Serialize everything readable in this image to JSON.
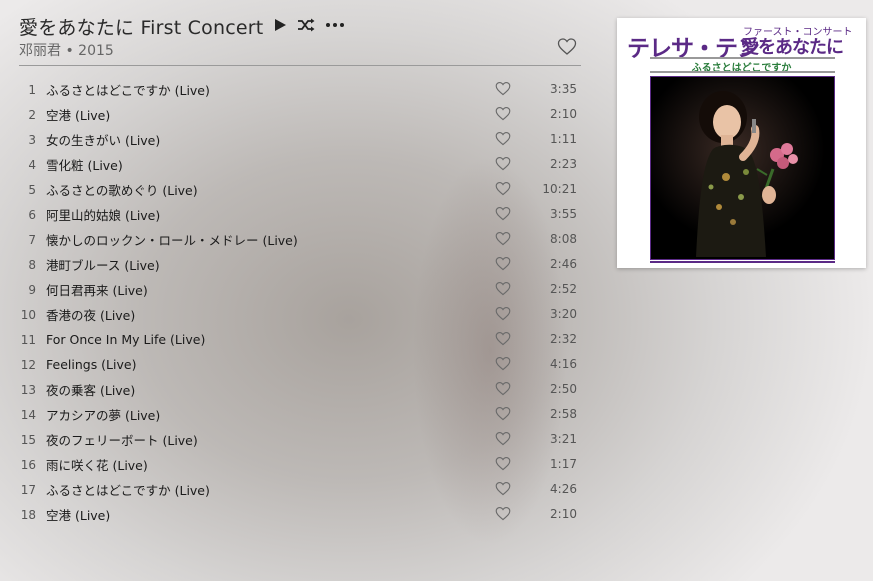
{
  "album": {
    "title": "愛をあなたに First Concert",
    "artist": "邓丽君",
    "year": "2015",
    "controls": [
      "play-icon",
      "shuffle-icon",
      "more-icon"
    ]
  },
  "cover": {
    "big_title": "テレサ・テン",
    "small_title": "ファースト・コンサート",
    "big_title2": "愛をあなたに",
    "subtitle": "ふるさとはどこですか"
  },
  "tracks": [
    {
      "num": "1",
      "title": "ふるさとはどこですか (Live)",
      "duration": "3:35"
    },
    {
      "num": "2",
      "title": "空港 (Live)",
      "duration": "2:10"
    },
    {
      "num": "3",
      "title": "女の生きがい (Live)",
      "duration": "1:11"
    },
    {
      "num": "4",
      "title": "雪化粧 (Live)",
      "duration": "2:23"
    },
    {
      "num": "5",
      "title": "ふるさとの歌めぐり (Live)",
      "duration": "10:21"
    },
    {
      "num": "6",
      "title": "阿里山的姑娘 (Live)",
      "duration": "3:55"
    },
    {
      "num": "7",
      "title": "懐かしのロックン・ロール・メドレー (Live)",
      "duration": "8:08"
    },
    {
      "num": "8",
      "title": "港町ブルース (Live)",
      "duration": "2:46"
    },
    {
      "num": "9",
      "title": "何日君再来 (Live)",
      "duration": "2:52"
    },
    {
      "num": "10",
      "title": "香港の夜 (Live)",
      "duration": "3:20"
    },
    {
      "num": "11",
      "title": "For Once In My Life (Live)",
      "duration": "2:32"
    },
    {
      "num": "12",
      "title": "Feelings (Live)",
      "duration": "4:16"
    },
    {
      "num": "13",
      "title": "夜の乗客 (Live)",
      "duration": "2:50"
    },
    {
      "num": "14",
      "title": "アカシアの夢 (Live)",
      "duration": "2:58"
    },
    {
      "num": "15",
      "title": "夜のフェリーボート (Live)",
      "duration": "3:21"
    },
    {
      "num": "16",
      "title": "雨に咲く花 (Live)",
      "duration": "1:17"
    },
    {
      "num": "17",
      "title": "ふるさとはどこですか (Live)",
      "duration": "4:26"
    },
    {
      "num": "18",
      "title": "空港 (Live)",
      "duration": "2:10"
    }
  ]
}
